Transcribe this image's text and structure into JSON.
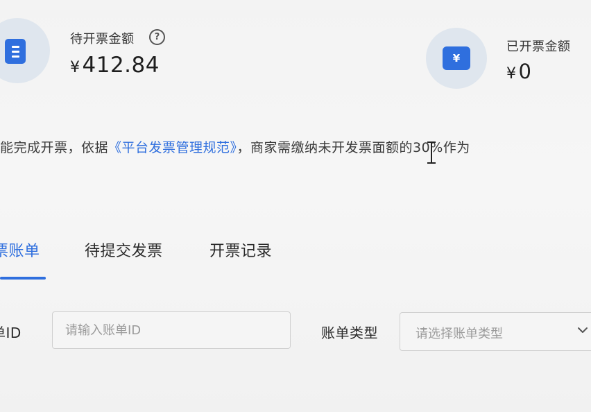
{
  "summary": {
    "pending": {
      "label": "待开票金额",
      "currency": "¥",
      "amount": "412.84",
      "help_glyph": "?"
    },
    "issued": {
      "label": "已开票金额",
      "currency": "¥",
      "amount": "0",
      "icon_glyph": "¥"
    }
  },
  "notice": {
    "before": "能完成开票，依据",
    "link": "《平台发票管理规范》",
    "after": "，商家需缴纳未开发票面额的30%作为"
  },
  "tabs": [
    {
      "label": "票账单",
      "active": true
    },
    {
      "label": "待提交发票",
      "active": false
    },
    {
      "label": "开票记录",
      "active": false
    }
  ],
  "filters": {
    "bill_id": {
      "label": "单ID",
      "placeholder": "请输入账单ID"
    },
    "bill_type": {
      "label": "账单类型",
      "placeholder": "请选择账单类型"
    }
  },
  "colors": {
    "accent": "#2f6fde",
    "icon_bg": "#dfe6ee"
  },
  "icons": {
    "pending": "document-icon",
    "issued": "yen-wallet-icon",
    "help": "question-circle-icon",
    "dropdown": "chevron-down-icon",
    "cursor": "text-cursor-icon"
  }
}
